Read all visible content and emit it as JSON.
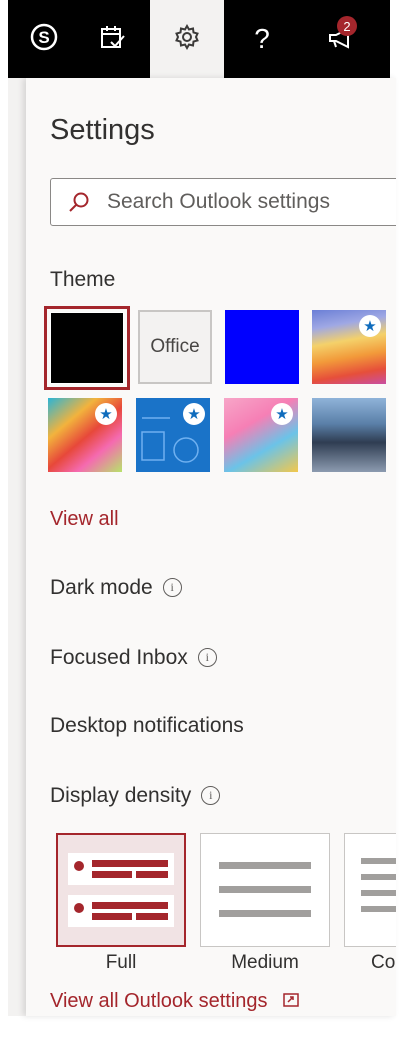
{
  "topbar": {
    "icons": [
      "skype-icon",
      "calendar-check-icon",
      "gear-icon",
      "help-icon",
      "megaphone-icon"
    ],
    "help_glyph": "?",
    "notification_count": "2",
    "active": "settings"
  },
  "settings": {
    "title": "Settings",
    "search": {
      "placeholder": "Search Outlook settings",
      "value": ""
    },
    "theme": {
      "label": "Theme",
      "office_tile_label": "Office",
      "star_glyph": "★",
      "selected": "black",
      "view_all": "View all"
    },
    "dark_mode": {
      "label": "Dark mode",
      "info_glyph": "i"
    },
    "focused_inbox": {
      "label": "Focused Inbox",
      "info_glyph": "i"
    },
    "desktop_notifications": {
      "label": "Desktop notifications"
    },
    "display_density": {
      "label": "Display density",
      "info_glyph": "i",
      "options": [
        "Full",
        "Medium",
        "Compact"
      ],
      "selected": "Full"
    },
    "footer_link": "View all Outlook settings"
  },
  "colors": {
    "accent": "#a4262c",
    "topbar": "#000000",
    "panel": "#faf9f8",
    "blue_theme": "#0000ff"
  }
}
